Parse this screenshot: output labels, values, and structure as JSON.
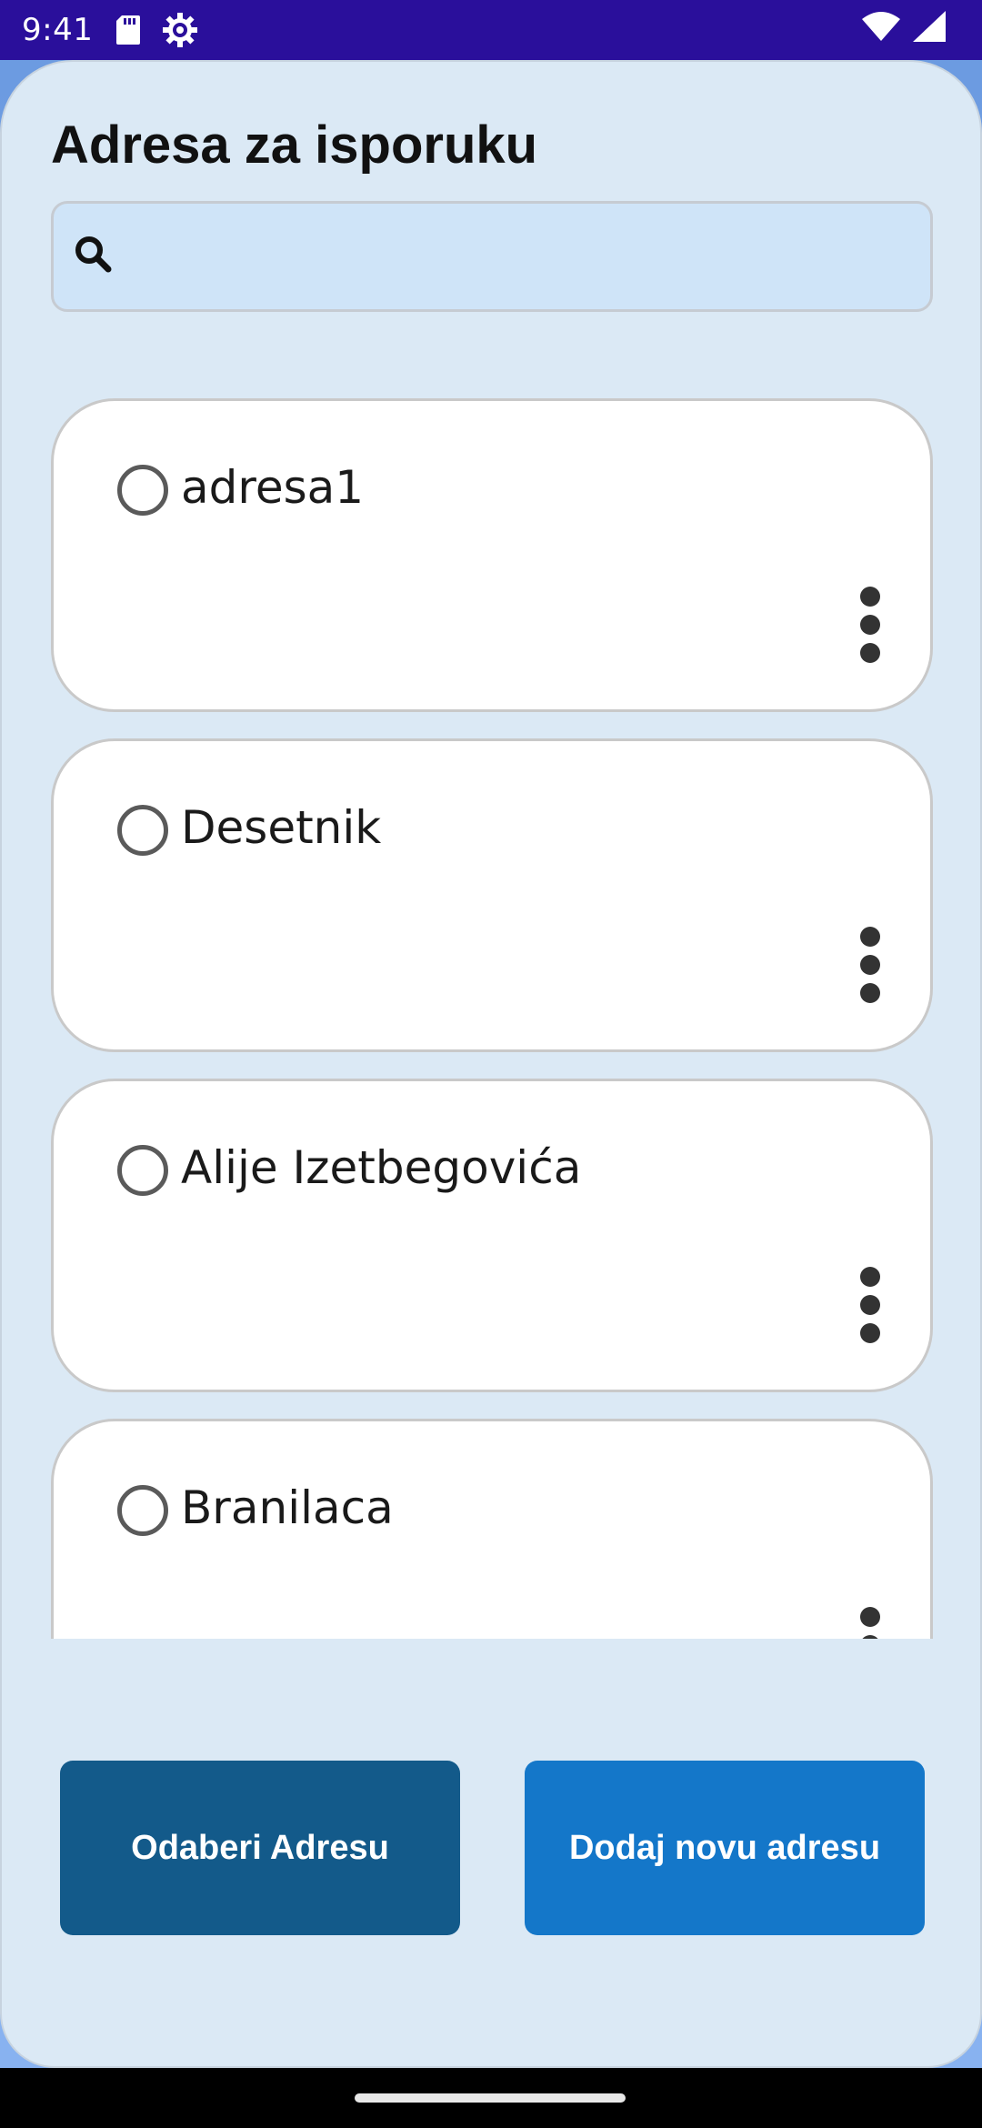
{
  "status_bar": {
    "time": "9:41",
    "icons": [
      "sd-card-icon",
      "settings-gear-icon",
      "wifi-icon",
      "cell-signal-icon"
    ]
  },
  "page": {
    "title": "Adresa za isporuku"
  },
  "search": {
    "placeholder": "",
    "value": ""
  },
  "addresses": [
    {
      "label": "adresa1",
      "selected": false
    },
    {
      "label": "Desetnik",
      "selected": false
    },
    {
      "label": "Alije Izetbegovića",
      "selected": false
    },
    {
      "label": "Branilaca",
      "selected": false
    }
  ],
  "actions": {
    "select_label": "Odaberi Adresu",
    "add_label": "Dodaj novu adresu"
  },
  "colors": {
    "status_bar": "#2a0f9b",
    "sheet_bg": "#dbe9f5",
    "search_bg": "#cfe4f8",
    "select_button": "#135a8a",
    "add_button": "#1477c9"
  }
}
